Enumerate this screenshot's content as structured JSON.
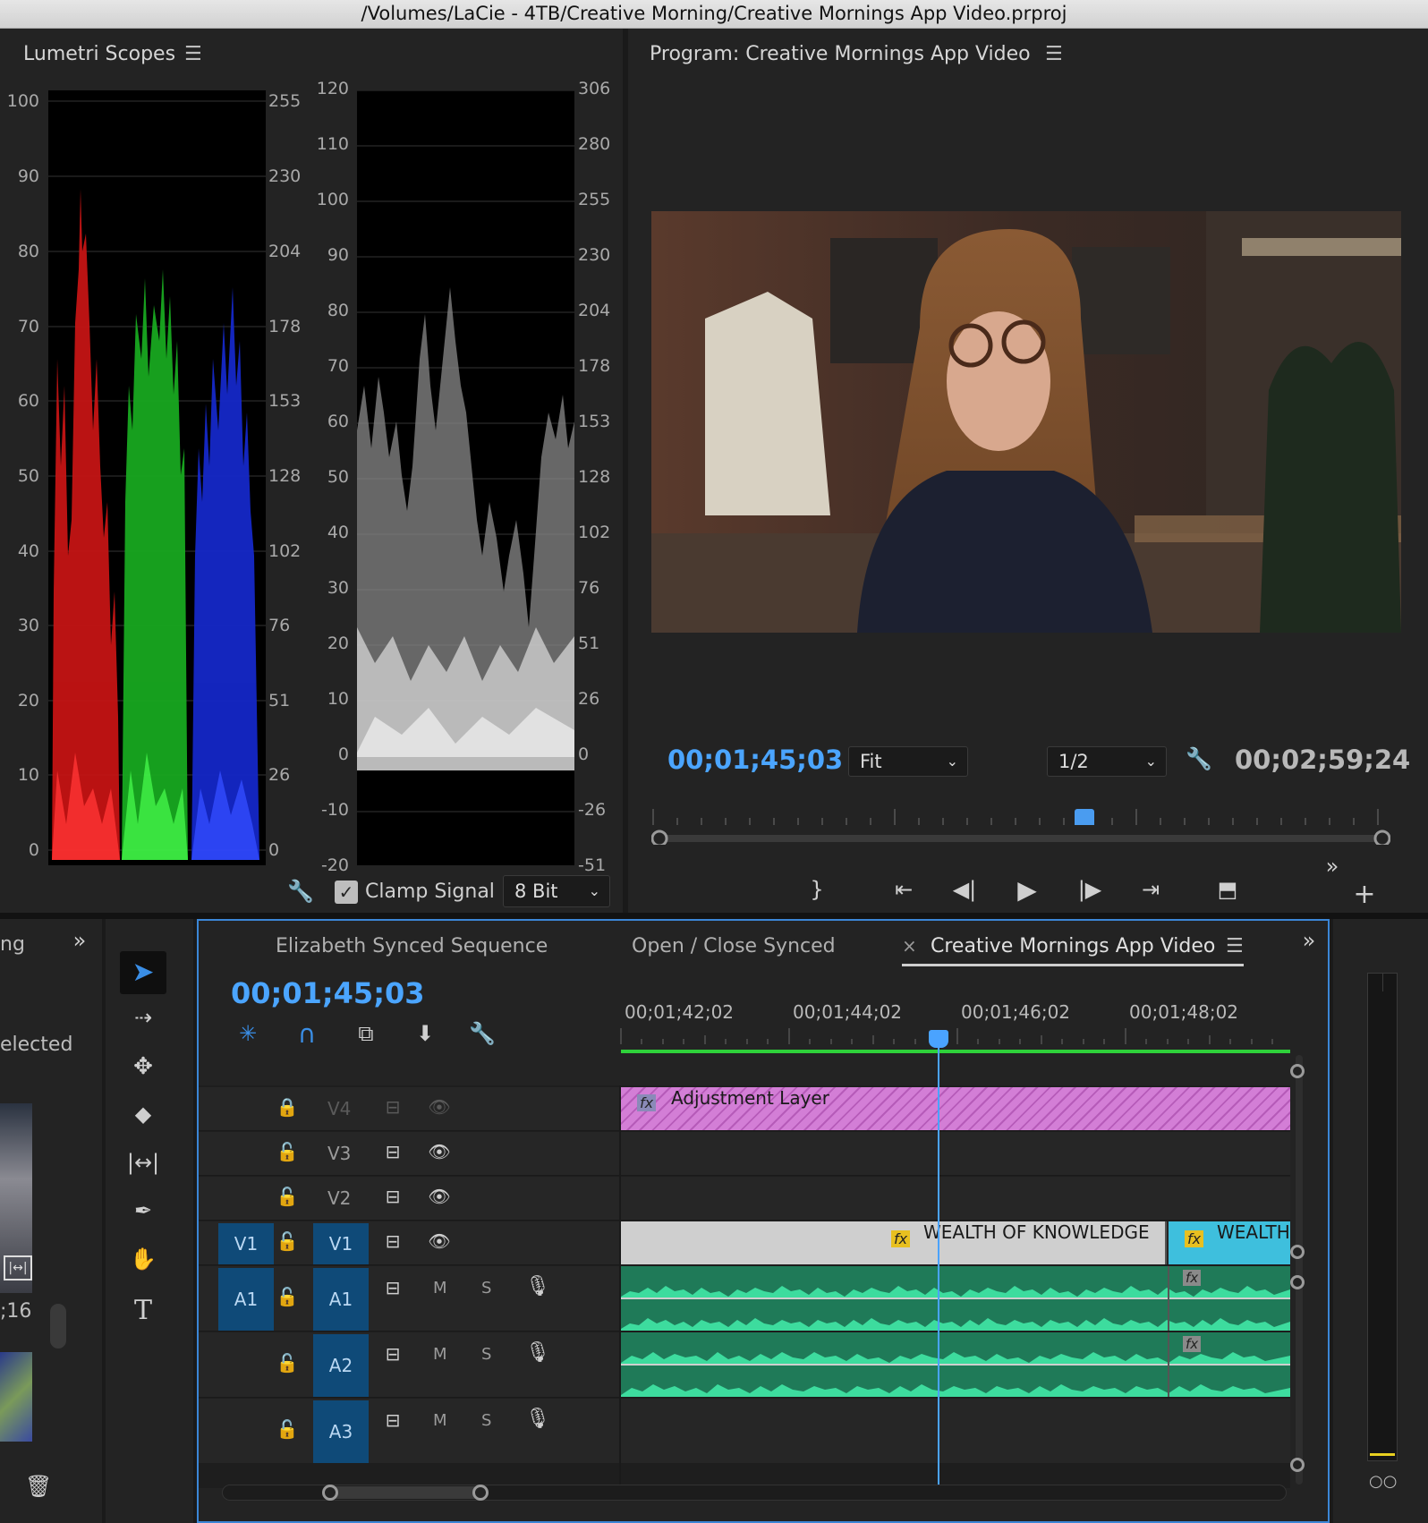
{
  "window": {
    "title": "/Volumes/LaCie - 4TB/Creative Morning/Creative Mornings App Video.prproj"
  },
  "scopes": {
    "title": "Lumetri Scopes",
    "parade_left_ticks": [
      "100",
      "90",
      "80",
      "70",
      "60",
      "50",
      "40",
      "30",
      "20",
      "10",
      "0"
    ],
    "parade_right_ticks": [
      "255",
      "230",
      "204",
      "178",
      "153",
      "128",
      "102",
      "76",
      "51",
      "26",
      "0"
    ],
    "wave_left_ticks": [
      "120",
      "110",
      "100",
      "90",
      "80",
      "70",
      "60",
      "50",
      "40",
      "30",
      "20",
      "10",
      "0",
      "-10",
      "-20"
    ],
    "wave_right_ticks": [
      "306",
      "280",
      "255",
      "230",
      "204",
      "178",
      "153",
      "128",
      "102",
      "76",
      "51",
      "26",
      "0",
      "-26",
      "-51"
    ],
    "clamp_label": "Clamp Signal",
    "bit_depth": "8 Bit",
    "colors": {
      "red": "#e01818",
      "green": "#22c42a",
      "blue": "#1b33e0"
    }
  },
  "program": {
    "title": "Program: Creative Mornings App Video",
    "timecode_current": "00;01;45;03",
    "timecode_duration": "00;02;59;24",
    "zoom": "Fit",
    "resolution": "1/2",
    "playhead_fraction": 0.58
  },
  "leftpanel": {
    "tab_partial": "ng",
    "selected_partial": "elected",
    "count_partial": ";16"
  },
  "timeline": {
    "tabs": [
      "Elizabeth Synced Sequence",
      "Open / Close Synced",
      "Creative Mornings App Video"
    ],
    "close_label": "×",
    "timecode": "00;01;45;03",
    "ruler_labels": [
      "00;01;42;02",
      "00;01;44;02",
      "00;01;46;02",
      "00;01;48;02"
    ],
    "tracks": {
      "v4": "V4",
      "v3": "V3",
      "v2": "V2",
      "v1": "V1",
      "v1_src": "V1",
      "a1": "A1",
      "a1_src": "A1",
      "a2": "A2",
      "a3": "A3",
      "m": "M",
      "s": "S"
    },
    "clips": {
      "adjustment": "Adjustment Layer",
      "wealth1": "WEALTH OF KNOWLEDGE",
      "wealth2": "WEALTH",
      "fx": "fx"
    },
    "colors": {
      "adjustment": "#d37ed6",
      "wealth1": "#cfcfcf",
      "wealth2": "#3ebfdd",
      "audio": "#1f7a58",
      "audio_wave": "#3ddc9e",
      "playhead": "#4aa3ff"
    }
  }
}
